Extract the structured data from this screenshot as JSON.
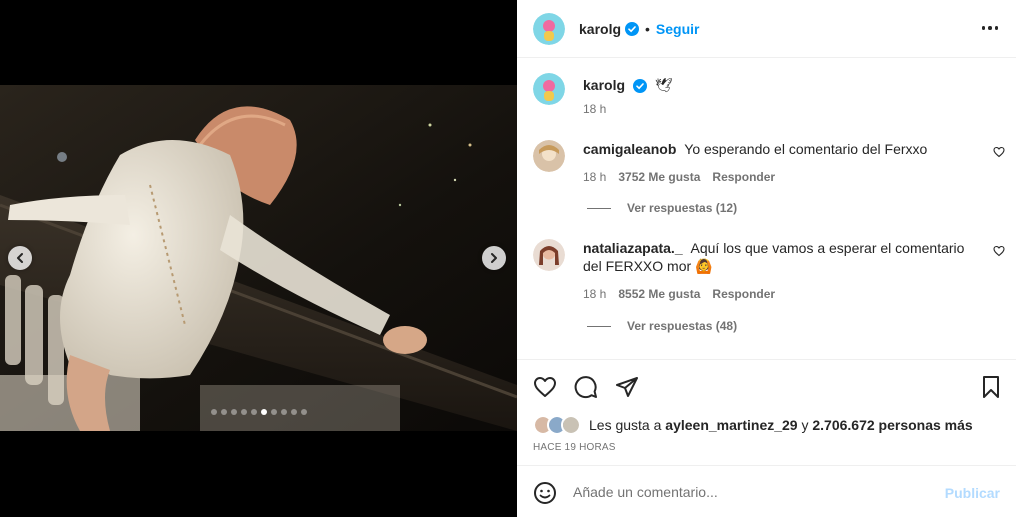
{
  "media": {
    "prev_icon": "chevron-left-icon",
    "next_icon": "chevron-right-icon",
    "carousel": {
      "total": 10,
      "active_index": 5
    }
  },
  "header": {
    "username": "karolg",
    "separator": "•",
    "follow_label": "Seguir",
    "more_icon": "more-horizontal-icon"
  },
  "caption": {
    "username": "karolg",
    "text": "🕊",
    "time": "18 h"
  },
  "comments": [
    {
      "username": "camigaleanob",
      "text": "Yo esperando el comentario del Ferxxo",
      "time": "18 h",
      "likes": "3752 Me gusta",
      "reply_label": "Responder",
      "view_replies": "Ver respuestas (12)"
    },
    {
      "username": "nataliazapata._",
      "text": "Aquí los que vamos a esperar el comentario del FERXXO mor 🙆",
      "time": "18 h",
      "likes": "8552 Me gusta",
      "reply_label": "Responder",
      "view_replies": "Ver respuestas (48)"
    }
  ],
  "actions": {
    "like_icon": "heart-icon",
    "comment_icon": "comment-icon",
    "share_icon": "send-icon",
    "save_icon": "bookmark-icon"
  },
  "likes": {
    "prefix": "Les gusta a",
    "user": "ayleen_martinez_29",
    "connector": "y",
    "others": "2.706.672 personas más"
  },
  "time_ago": "HACE 19 HORAS",
  "add_comment": {
    "emoji_icon": "emoji-icon",
    "placeholder": "Añade un comentario...",
    "publish_label": "Publicar"
  },
  "colors": {
    "accent": "#0095f6",
    "publish_disabled": "#b3dbff",
    "muted": "#737373",
    "text": "#262626",
    "verified": "#0095f6"
  }
}
